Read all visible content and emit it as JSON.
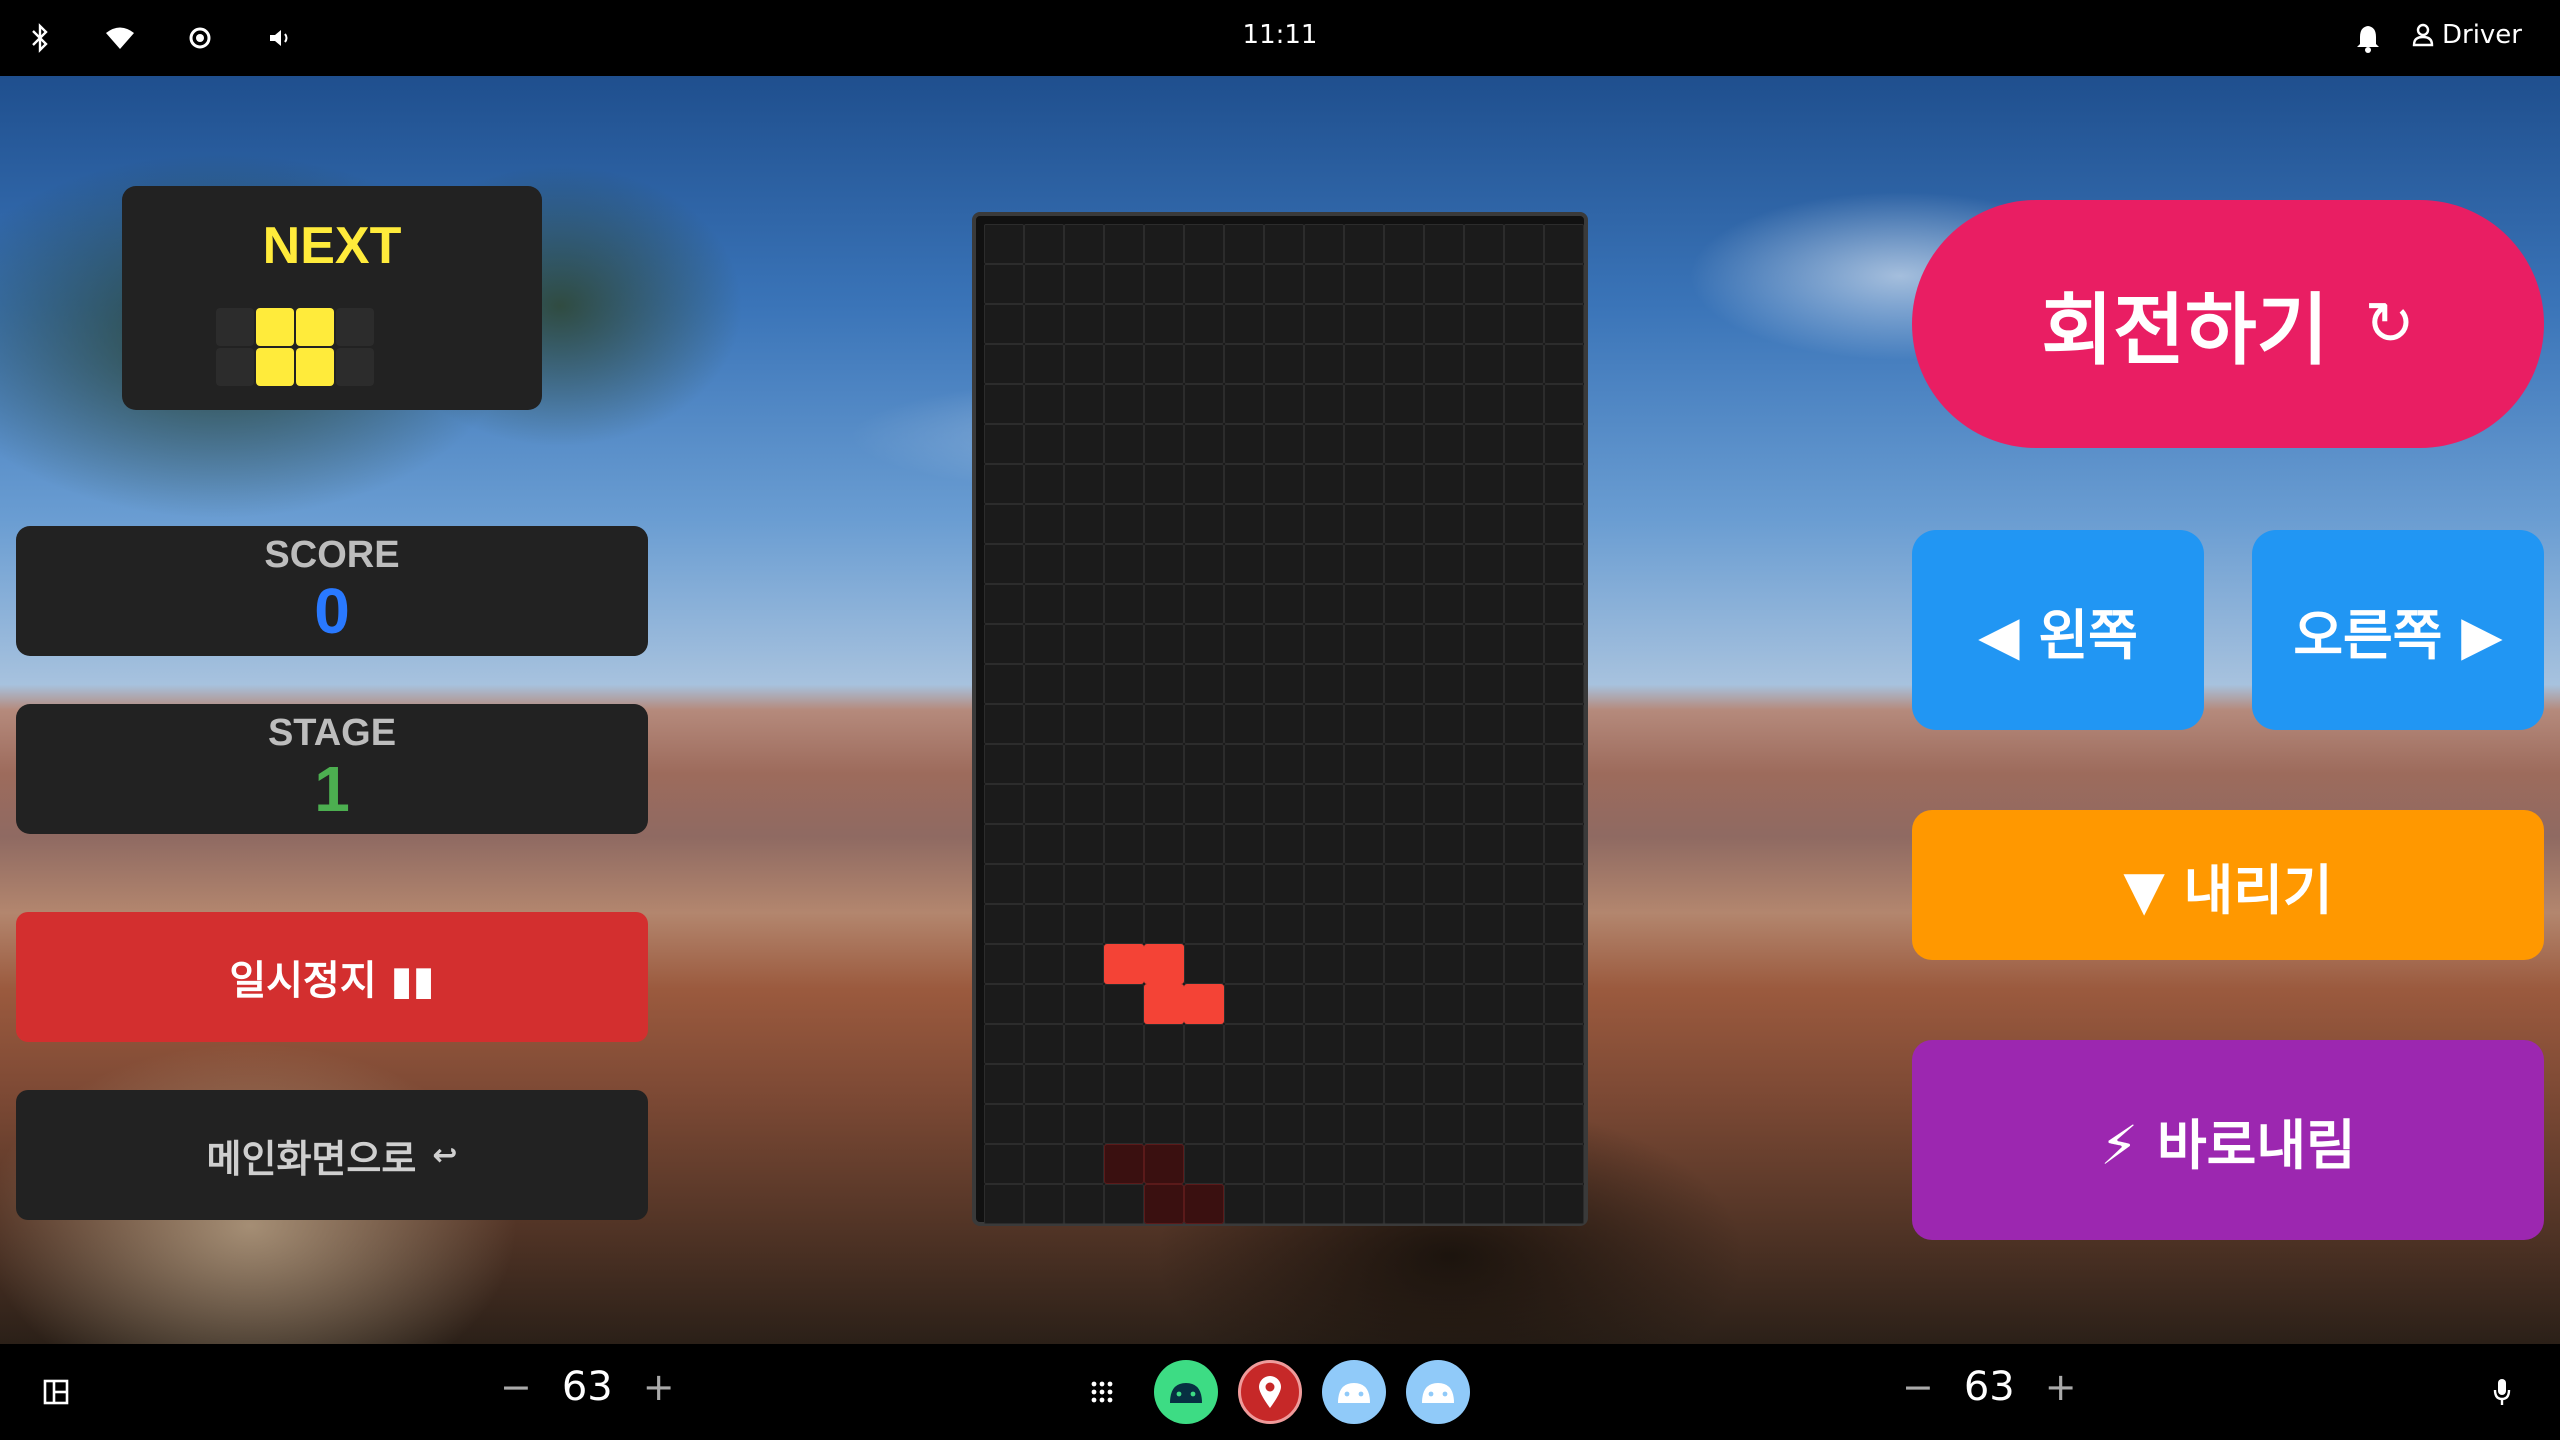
{
  "status_bar": {
    "time": "11:11",
    "user_label": "Driver",
    "icons": [
      "bluetooth-icon",
      "wifi-icon",
      "brightness-icon",
      "volume-icon",
      "bell-icon",
      "user-icon"
    ]
  },
  "game": {
    "next_label": "NEXT",
    "next_piece": "O",
    "score_label": "SCORE",
    "score_value": "0",
    "stage_label": "STAGE",
    "stage_value": "1",
    "pause_label": "일시정지 ▮▮",
    "menu_label": "메인화면으로",
    "menu_glyph": "↩",
    "board": {
      "columns": 15,
      "rows": 25
    },
    "active_piece": {
      "type": "Z",
      "cells": [
        [
          3,
          18
        ],
        [
          4,
          18
        ],
        [
          4,
          19
        ],
        [
          5,
          19
        ]
      ],
      "color": "#f44336"
    },
    "ghost_piece": {
      "type": "Z",
      "cells": [
        [
          3,
          23
        ],
        [
          4,
          23
        ],
        [
          4,
          24
        ],
        [
          5,
          24
        ]
      ],
      "color": "#3a1010"
    }
  },
  "controls": {
    "rotate_label": "회전하기",
    "rotate_glyph": "↻",
    "left_label": "◀ 왼쪽",
    "right_label": "오른쪽 ▶",
    "down_label": "▼ 내리기",
    "drop_label": "⚡ 바로내림"
  },
  "nav_bar": {
    "left_temp": "63",
    "right_temp": "63",
    "minus": "−",
    "plus": "+",
    "apps": [
      "android-app-icon",
      "maps-app-icon",
      "android-app-icon",
      "android-app-icon"
    ]
  },
  "colors": {
    "next_title": "#ffeb3b",
    "score": "#2979ff",
    "stage": "#4caf50",
    "pause": "#d32f2f",
    "rotate": "#e91e63",
    "move": "#2196f3",
    "down": "#ff9800",
    "drop": "#9c27b0",
    "next_piece": "#ffeb3b"
  }
}
